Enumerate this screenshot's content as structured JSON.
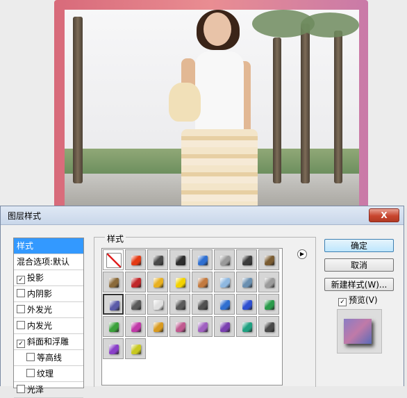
{
  "dialog": {
    "title": "图层样式",
    "close_label": "X",
    "left_panel": {
      "items": [
        {
          "label": "样式",
          "selected": true,
          "checkbox": false
        },
        {
          "label": "混合选项:默认",
          "selected": false,
          "checkbox": false
        },
        {
          "label": "投影",
          "checkbox": true,
          "checked": true
        },
        {
          "label": "内阴影",
          "checkbox": true,
          "checked": false
        },
        {
          "label": "外发光",
          "checkbox": true,
          "checked": false
        },
        {
          "label": "内发光",
          "checkbox": true,
          "checked": false
        },
        {
          "label": "斜面和浮雕",
          "checkbox": true,
          "checked": true
        },
        {
          "label": "等高线",
          "checkbox": true,
          "checked": false,
          "indent": true
        },
        {
          "label": "纹理",
          "checkbox": true,
          "checked": false,
          "indent": true
        },
        {
          "label": "光泽",
          "checkbox": true,
          "checked": false
        }
      ]
    },
    "styles_group_label": "样式",
    "buttons": {
      "ok": "确定",
      "cancel": "取消",
      "new_style": "新建样式(W)...",
      "preview": "预览(V)"
    },
    "preview_checked": true,
    "style_swatches": [
      [
        "none-red-slash",
        "#e33a14",
        "#4a4a4a",
        "#2e2e2e",
        "#2f6fd0",
        "#9a9a9a",
        "#3c3c3c",
        "#7a5c32"
      ],
      [
        "#8a6a3a",
        "#c0282a",
        "#e8b020",
        "#f2d200",
        "#c27a40",
        "#8fb8e0",
        "#6a8fb0",
        "#9a9a9a"
      ],
      [
        "#5a5aa8",
        "#5a5a5a",
        "#e0e0e0",
        "#5a5a5a",
        "#505050",
        "#2f6fd0",
        "#2e4fd0",
        "#2a9a4a"
      ],
      [
        "#3aa03a",
        "#c03aa8",
        "#d89a20",
        "#c05a90",
        "#a060c0",
        "#7a40b0",
        "#20a080",
        "#4a4a4a"
      ],
      [
        "#8a40c8",
        "#c8c820"
      ]
    ]
  }
}
